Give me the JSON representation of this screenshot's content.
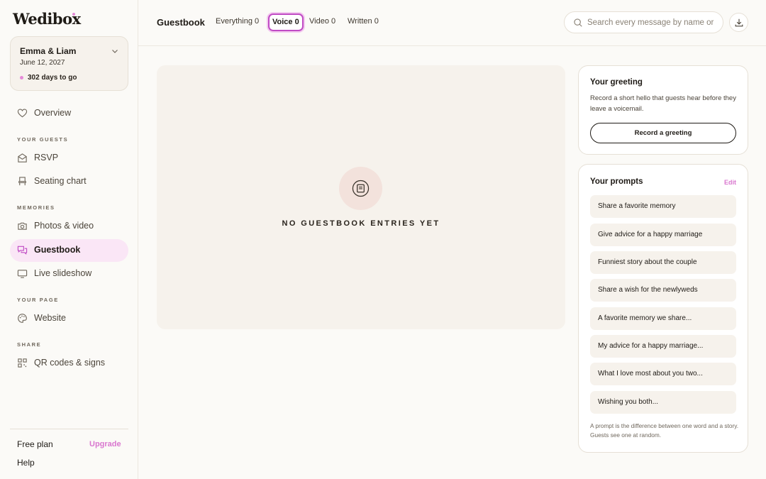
{
  "brand": {
    "logo": "Wedibox"
  },
  "event": {
    "names": "Emma & Liam",
    "date": "June 12, 2027",
    "countdown": "302 days to go"
  },
  "sidebar": {
    "overview": "Overview",
    "sections": {
      "guests": "YOUR GUESTS",
      "memories": "MEMORIES",
      "page": "YOUR PAGE",
      "share": "SHARE"
    },
    "items": {
      "rsvp": "RSVP",
      "seating": "Seating chart",
      "photos": "Photos & video",
      "guestbook": "Guestbook",
      "slideshow": "Live slideshow",
      "website": "Website",
      "qr": "QR codes & signs"
    },
    "footer": {
      "plan": "Free plan",
      "upgrade": "Upgrade",
      "help": "Help"
    }
  },
  "header": {
    "title": "Guestbook",
    "tabs": [
      {
        "label": "Everything 0"
      },
      {
        "label": "Voice 0",
        "active": true
      },
      {
        "label": "Video 0"
      },
      {
        "label": "Written 0"
      }
    ],
    "search": {
      "placeholder": "Search every message by name or keyword",
      "value": ""
    }
  },
  "main": {
    "empty_text": "NO GUESTBOOK ENTRIES YET"
  },
  "greeting": {
    "title": "Your greeting",
    "description": "Record a short hello that guests hear before they leave a voicemail.",
    "button": "Record a greeting"
  },
  "prompts": {
    "title": "Your prompts",
    "edit": "Edit",
    "items": [
      "Share a favorite memory",
      "Give advice for a happy marriage",
      "Funniest story about the couple",
      "Share a wish for the newlyweds",
      "A favorite memory we share...",
      "My advice for a happy marriage...",
      "What I love most about you two...",
      "Wishing you both..."
    ],
    "footnote": "A prompt is the difference between one word and a story. Guests see one at random."
  },
  "colors": {
    "accent": "#d977cf",
    "active_nav": "#fae6f6",
    "panel": "#f6f2ec",
    "tab_focus": "#c04bc4"
  }
}
